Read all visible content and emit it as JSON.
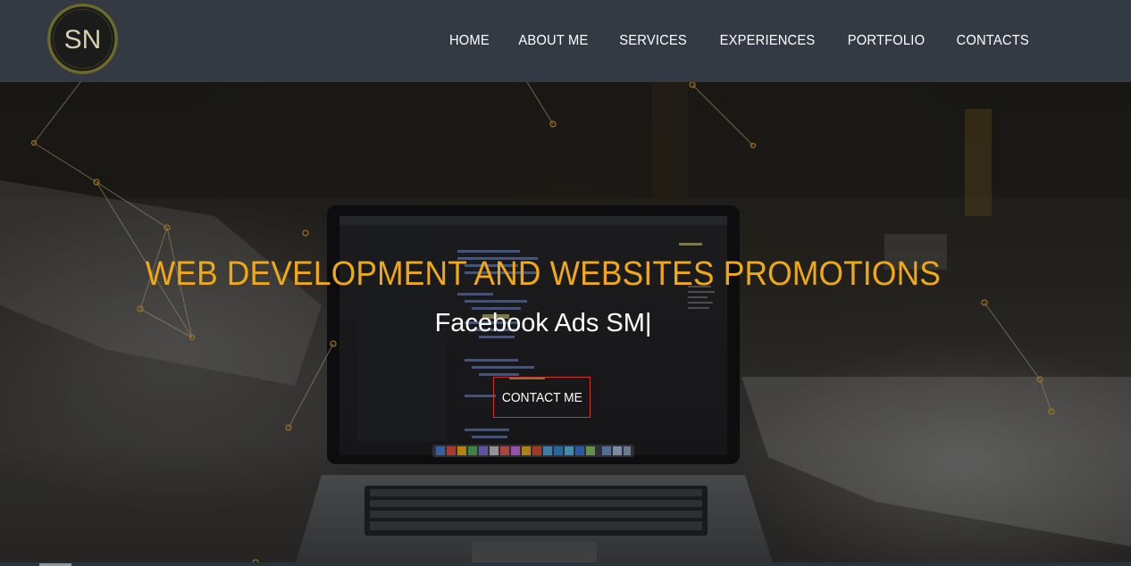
{
  "header": {
    "logo_text": "SN",
    "nav": [
      {
        "label": "HOME"
      },
      {
        "label": "ABOUT ME"
      },
      {
        "label": "SERVICES"
      },
      {
        "label": "EXPERIENCES"
      },
      {
        "label": "PORTFOLIO"
      },
      {
        "label": "CONTACTS"
      }
    ]
  },
  "hero": {
    "title": "WEB DEVELOPMENT AND WEBSITES PROMOTIONS",
    "subtitle": "Facebook Ads SM|",
    "cta_label": "CONTACT ME"
  },
  "colors": {
    "header_bg": "#333a44",
    "accent": "#f0a814",
    "cta_border": "#c9342d",
    "nav_text": "#ffffff"
  }
}
